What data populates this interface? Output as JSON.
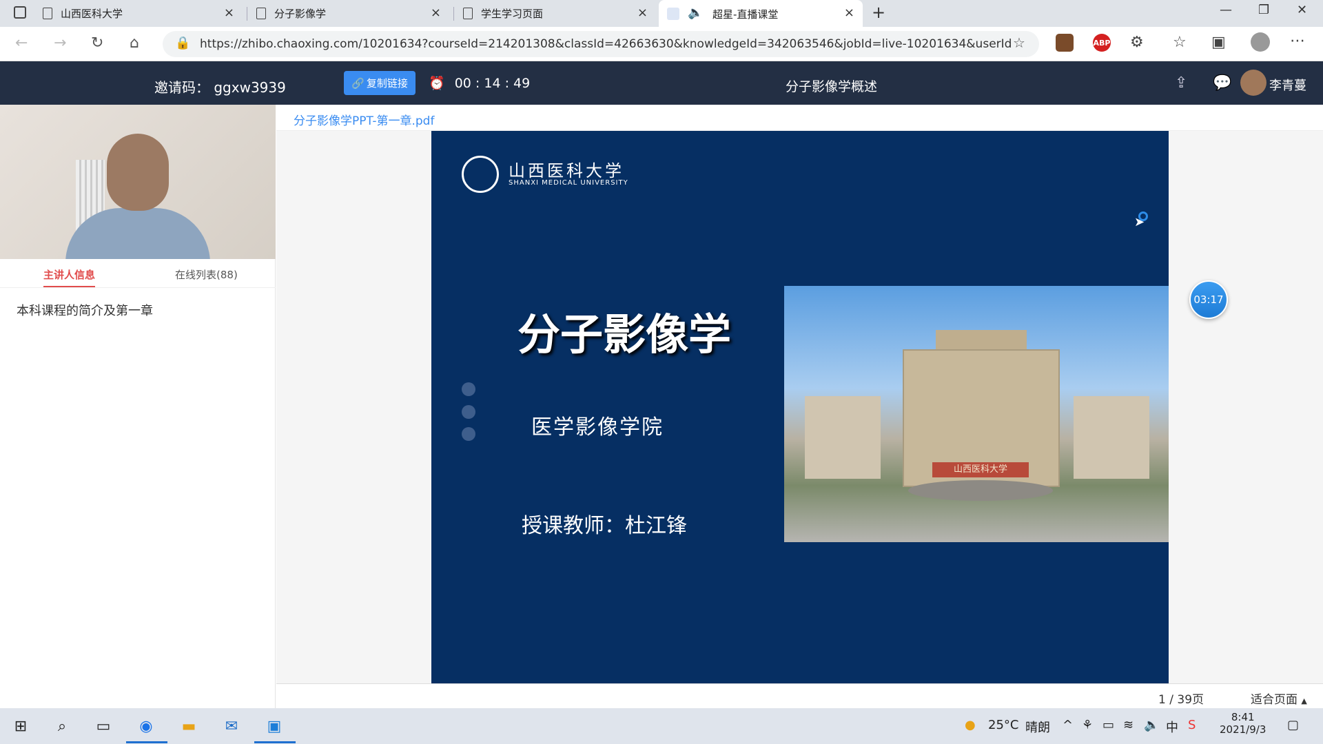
{
  "browser": {
    "tabs": [
      {
        "title": "山西医科大学"
      },
      {
        "title": "分子影像学"
      },
      {
        "title": "学生学习页面"
      },
      {
        "title": "超星-直播课堂"
      }
    ],
    "url": "https://zhibo.chaoxing.com/10201634?courseId=214201308&classId=42663630&knowledgeId=342063546&jobId=live-10201634&userId=10307309..."
  },
  "header": {
    "invite_label": "邀请码：",
    "invite_code": "ggxw3939",
    "copy_link": "复制链接",
    "elapsed": "00 : 14 : 49",
    "course_title": "分子影像学概述",
    "user_name": "李青蔓"
  },
  "left_panel": {
    "tabs": [
      "主讲人信息",
      "在线列表(88)"
    ],
    "description": "本科课程的简介及第一章"
  },
  "document": {
    "filename": "分子影像学PPT-第一章.pdf",
    "page_current": "1",
    "page_total": "39页",
    "fit_label": "适合页面",
    "countdown": "03:17"
  },
  "slide": {
    "university_cn": "山西医科大学",
    "university_en": "SHANXI MEDICAL UNIVERSITY",
    "title": "分子影像学",
    "college": "医学影像学院",
    "teacher": "授课教师：杜江锋",
    "gate_sign": "山西医科大学"
  },
  "taskbar": {
    "temperature": "25°C",
    "weather": "晴朗",
    "ime": "中",
    "time": "8:41",
    "date": "2021/9/3"
  }
}
